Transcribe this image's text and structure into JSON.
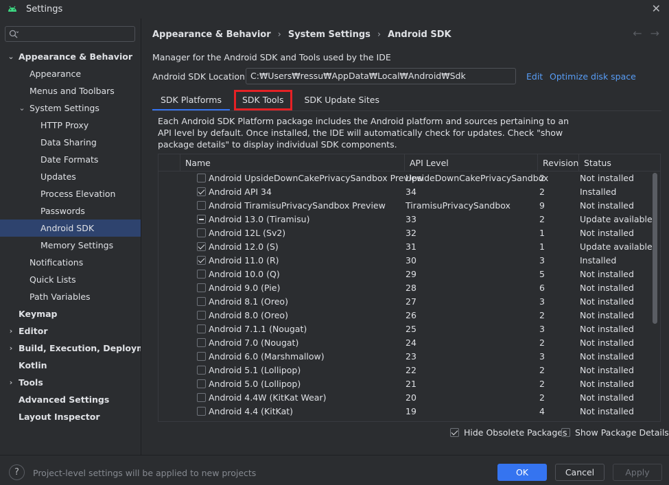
{
  "window": {
    "title": "Settings"
  },
  "search": {
    "placeholder": "",
    "value": ""
  },
  "sidebar": {
    "items": [
      {
        "label": "Appearance & Behavior",
        "level": 0,
        "bold": true,
        "arrow": "⌄"
      },
      {
        "label": "Appearance",
        "level": 1
      },
      {
        "label": "Menus and Toolbars",
        "level": 1
      },
      {
        "label": "System Settings",
        "level": 1,
        "arrow": "⌄"
      },
      {
        "label": "HTTP Proxy",
        "level": 2
      },
      {
        "label": "Data Sharing",
        "level": 2
      },
      {
        "label": "Date Formats",
        "level": 2
      },
      {
        "label": "Updates",
        "level": 2
      },
      {
        "label": "Process Elevation",
        "level": 2
      },
      {
        "label": "Passwords",
        "level": 2
      },
      {
        "label": "Android SDK",
        "level": 2,
        "selected": true
      },
      {
        "label": "Memory Settings",
        "level": 2
      },
      {
        "label": "Notifications",
        "level": 1
      },
      {
        "label": "Quick Lists",
        "level": 1
      },
      {
        "label": "Path Variables",
        "level": 1
      },
      {
        "label": "Keymap",
        "level": 0,
        "bold": true
      },
      {
        "label": "Editor",
        "level": 0,
        "bold": true,
        "arrow": "›"
      },
      {
        "label": "Build, Execution, Deployment",
        "level": 0,
        "bold": true,
        "arrow": "›"
      },
      {
        "label": "Kotlin",
        "level": 0,
        "bold": true
      },
      {
        "label": "Tools",
        "level": 0,
        "bold": true,
        "arrow": "›"
      },
      {
        "label": "Advanced Settings",
        "level": 0,
        "bold": true
      },
      {
        "label": "Layout Inspector",
        "level": 0,
        "bold": true
      }
    ]
  },
  "breadcrumb": [
    "Appearance & Behavior",
    "System Settings",
    "Android SDK"
  ],
  "main": {
    "description": "Manager for the Android SDK and Tools used by the IDE",
    "location_label": "Android SDK Location:",
    "location_value": "C:₩Users₩ressu₩AppData₩Local₩Android₩Sdk",
    "edit_link": "Edit",
    "optimize_link": "Optimize disk space",
    "tabs": [
      {
        "label": "SDK Platforms",
        "active": true
      },
      {
        "label": "SDK Tools",
        "highlight": true
      },
      {
        "label": "SDK Update Sites"
      }
    ],
    "platform_description": "Each Android SDK Platform package includes the Android platform and sources pertaining to an API level by default. Once installed, the IDE will automatically check for updates. Check \"show package details\" to display individual SDK components.",
    "columns": [
      "Name",
      "API Level",
      "Revision",
      "Status"
    ],
    "rows": [
      {
        "check": "none",
        "name": "Android UpsideDownCakePrivacySandbox Preview",
        "api": "UpsideDownCakePrivacySandbox",
        "rev": "2",
        "status": "Not installed"
      },
      {
        "check": "checked",
        "name": "Android API 34",
        "api": "34",
        "rev": "2",
        "status": "Installed"
      },
      {
        "check": "none",
        "name": "Android TiramisuPrivacySandbox Preview",
        "api": "TiramisuPrivacySandbox",
        "rev": "9",
        "status": "Not installed"
      },
      {
        "check": "partial",
        "name": "Android 13.0 (Tiramisu)",
        "api": "33",
        "rev": "2",
        "status": "Update available"
      },
      {
        "check": "none",
        "name": "Android 12L (Sv2)",
        "api": "32",
        "rev": "1",
        "status": "Not installed"
      },
      {
        "check": "checked",
        "name": "Android 12.0 (S)",
        "api": "31",
        "rev": "1",
        "status": "Update available"
      },
      {
        "check": "checked",
        "name": "Android 11.0 (R)",
        "api": "30",
        "rev": "3",
        "status": "Installed"
      },
      {
        "check": "none",
        "name": "Android 10.0 (Q)",
        "api": "29",
        "rev": "5",
        "status": "Not installed"
      },
      {
        "check": "none",
        "name": "Android 9.0 (Pie)",
        "api": "28",
        "rev": "6",
        "status": "Not installed"
      },
      {
        "check": "none",
        "name": "Android 8.1 (Oreo)",
        "api": "27",
        "rev": "3",
        "status": "Not installed"
      },
      {
        "check": "none",
        "name": "Android 8.0 (Oreo)",
        "api": "26",
        "rev": "2",
        "status": "Not installed"
      },
      {
        "check": "none",
        "name": "Android 7.1.1 (Nougat)",
        "api": "25",
        "rev": "3",
        "status": "Not installed"
      },
      {
        "check": "none",
        "name": "Android 7.0 (Nougat)",
        "api": "24",
        "rev": "2",
        "status": "Not installed"
      },
      {
        "check": "none",
        "name": "Android 6.0 (Marshmallow)",
        "api": "23",
        "rev": "3",
        "status": "Not installed"
      },
      {
        "check": "none",
        "name": "Android 5.1 (Lollipop)",
        "api": "22",
        "rev": "2",
        "status": "Not installed"
      },
      {
        "check": "none",
        "name": "Android 5.0 (Lollipop)",
        "api": "21",
        "rev": "2",
        "status": "Not installed"
      },
      {
        "check": "none",
        "name": "Android 4.4W (KitKat Wear)",
        "api": "20",
        "rev": "2",
        "status": "Not installed"
      },
      {
        "check": "none",
        "name": "Android 4.4 (KitKat)",
        "api": "19",
        "rev": "4",
        "status": "Not installed"
      }
    ],
    "hide_obsolete_label": "Hide Obsolete Packages",
    "hide_obsolete_checked": true,
    "show_details_label": "Show Package Details",
    "show_details_checked": false
  },
  "footer": {
    "help_label": "?",
    "note": "Project-level settings will be applied to new projects",
    "ok_label": "OK",
    "cancel_label": "Cancel",
    "apply_label": "Apply"
  },
  "colors": {
    "accent": "#3574f0",
    "highlight": "#e52125",
    "link": "#589df6",
    "selected": "#2e436e"
  }
}
